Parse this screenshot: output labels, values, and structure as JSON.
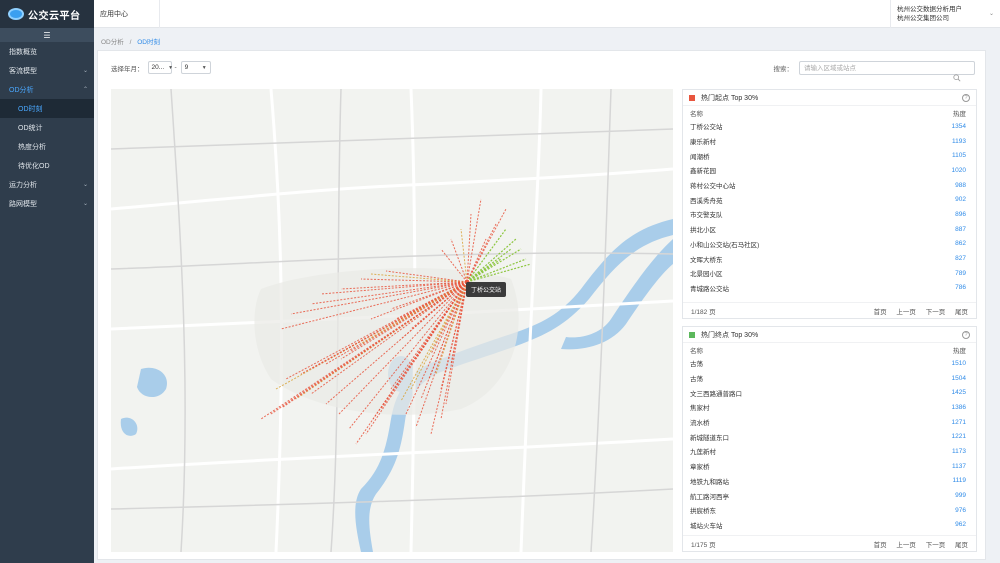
{
  "sidebar": {
    "logo_text": "公交云平台",
    "collapse_glyph": "☰",
    "items": [
      {
        "label": "指数概览",
        "arrow": ""
      },
      {
        "label": "客流模型",
        "arrow": "⌄"
      },
      {
        "label": "OD分析",
        "arrow": "⌃"
      },
      {
        "label": "OD时刻",
        "arrow": ""
      },
      {
        "label": "OD统计",
        "arrow": ""
      },
      {
        "label": "热度分析",
        "arrow": ""
      },
      {
        "label": "待优化OD",
        "arrow": ""
      },
      {
        "label": "运力分析",
        "arrow": "⌄"
      },
      {
        "label": "路网模型",
        "arrow": "⌄"
      }
    ]
  },
  "topbar": {
    "app_center": "应用中心",
    "user_line1": "杭州公交数据分析用户",
    "user_line2": "杭州公交集团公司"
  },
  "breadcrumb": {
    "parent": "OD分析",
    "sep": "/",
    "current": "OD时刻"
  },
  "filter": {
    "label": "选择年月：",
    "year": "20...",
    "dash": "-",
    "month": "9"
  },
  "search": {
    "label": "搜索：",
    "placeholder": "请输入区域或站点"
  },
  "map": {
    "tooltip": "丁桥公交站",
    "colors": {
      "flow": "#e8553e",
      "flow_alt": "#d9a43b",
      "flow_green": "#8cc63f",
      "water": "#a9cdea",
      "road": "#ffffff",
      "highway": "#d8d8d8"
    }
  },
  "origins": {
    "title": "热门起点 Top 30%",
    "col_name": "名称",
    "col_heat": "热度",
    "rows": [
      {
        "name": "丁桥公交站",
        "heat": "1354"
      },
      {
        "name": "康乐新村",
        "heat": "1193"
      },
      {
        "name": "闻潮桥",
        "heat": "1105"
      },
      {
        "name": "鑫新花园",
        "heat": "1020"
      },
      {
        "name": "蒋村公交中心站",
        "heat": "988"
      },
      {
        "name": "西溪秀舟苑",
        "heat": "902"
      },
      {
        "name": "市交警支队",
        "heat": "896"
      },
      {
        "name": "拱北小区",
        "heat": "887"
      },
      {
        "name": "小和山公交站(石马社区)",
        "heat": "862"
      },
      {
        "name": "文晖大桥东",
        "heat": "827"
      },
      {
        "name": "北景园小区",
        "heat": "789"
      },
      {
        "name": "青城路公交站",
        "heat": "786"
      }
    ],
    "page_info": "1/182 页",
    "pager": [
      "首页",
      "上一页",
      "下一页",
      "尾页"
    ]
  },
  "destinations": {
    "title": "热门终点 Top 30%",
    "col_name": "名称",
    "col_heat": "热度",
    "rows": [
      {
        "name": "古荡",
        "heat": "1510"
      },
      {
        "name": "古荡",
        "heat": "1504"
      },
      {
        "name": "文三西路通普路口",
        "heat": "1425"
      },
      {
        "name": "焦家村",
        "heat": "1386"
      },
      {
        "name": "流水桥",
        "heat": "1271"
      },
      {
        "name": "新城隧道东口",
        "heat": "1221"
      },
      {
        "name": "九莲新村",
        "heat": "1173"
      },
      {
        "name": "章家桥",
        "heat": "1137"
      },
      {
        "name": "地铁九和路站",
        "heat": "1119"
      },
      {
        "name": "航工路河西亭",
        "heat": "999"
      },
      {
        "name": "拱宸桥东",
        "heat": "976"
      },
      {
        "name": "城站火车站",
        "heat": "962"
      }
    ],
    "page_info": "1/175 页",
    "pager": [
      "首页",
      "上一页",
      "下一页",
      "尾页"
    ]
  }
}
